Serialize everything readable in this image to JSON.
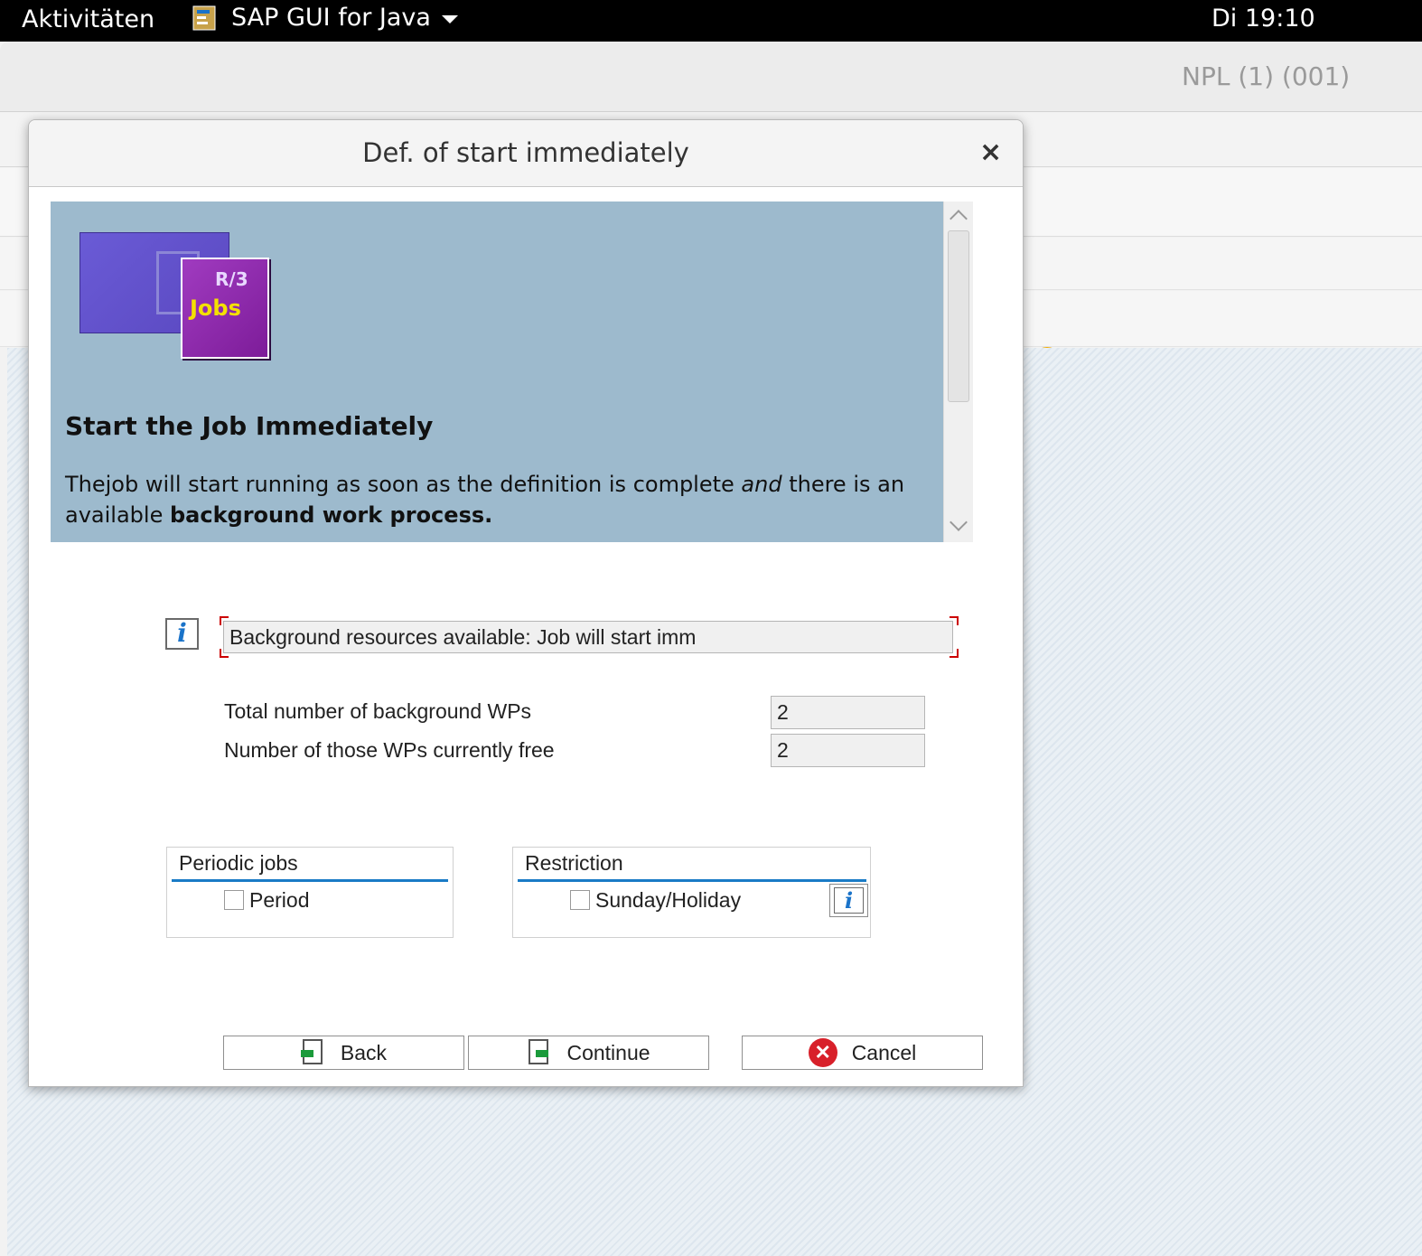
{
  "topbar": {
    "activities": "Aktivitäten",
    "app_name": "SAP GUI for Java",
    "clock": "Di 19:10"
  },
  "window": {
    "system": "NPL (1) (001)"
  },
  "dialog": {
    "title": "Def. of start immediately",
    "close_glyph": "×",
    "info": {
      "image_r3": "R/3",
      "image_jobs": "Jobs",
      "heading": "Start the Job Immediately",
      "desc_part1": "Thejob will start running as soon as the definition is complete ",
      "desc_em": "and",
      "desc_part2": " there is an available ",
      "desc_bold": "background work process."
    },
    "status_message": "Background resources available: Job will start imm",
    "fields": {
      "total_label": "Total number of background WPs",
      "total_value": "2",
      "free_label": "Number of those WPs currently free",
      "free_value": "2"
    },
    "periodic_group": {
      "title": "Periodic jobs",
      "checkbox_label": "Period",
      "checked": false
    },
    "restriction_group": {
      "title": "Restriction",
      "checkbox_label": "Sunday/Holiday",
      "checked": false
    },
    "buttons": {
      "back": "Back",
      "continue": "Continue",
      "cancel": "Cancel"
    }
  },
  "icons": {
    "help": "help-icon",
    "info": "info-icon",
    "back": "back-icon",
    "continue": "continue-icon",
    "cancel": "cancel-icon"
  },
  "colors": {
    "info_panel": "#9dbacd",
    "accent_line": "#1a7bc6",
    "help_icon": "#f0ab00",
    "cancel_icon": "#d8202a"
  }
}
